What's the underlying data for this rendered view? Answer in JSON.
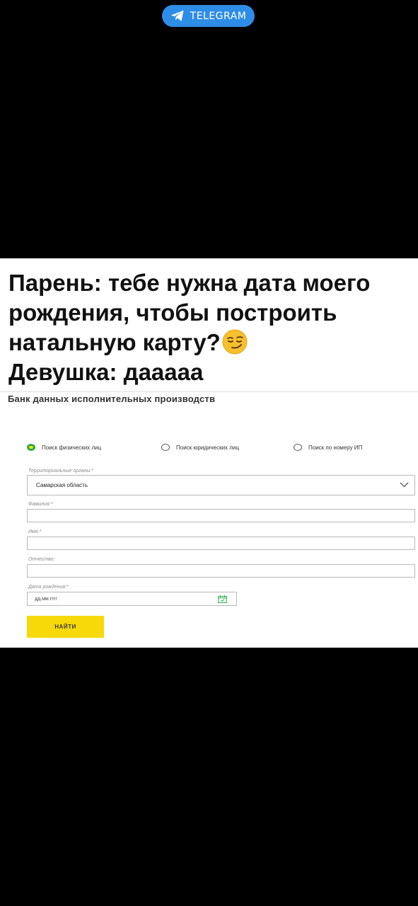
{
  "telegram_badge": {
    "label": "TELEGRAM"
  },
  "caption": {
    "lines": [
      "Парень: тебе нужна дата моего",
      "рождения, чтобы построить",
      "натальную карту?",
      "Девушка: даааaa"
    ],
    "emoji": "smirking-face"
  },
  "form": {
    "title": "Банк данных исполнительных производств",
    "radios": [
      {
        "label": "Поиск физических лиц",
        "selected": true
      },
      {
        "label": "Поиск юридических лиц",
        "selected": false
      },
      {
        "label": "Поиск по номеру ИП",
        "selected": false
      }
    ],
    "region_label": "Территориальные органы:*",
    "region_value": "Самарская область",
    "surname_label": "Фамилия:*",
    "name_label": "Имя:*",
    "patronymic_label": "Отчество:",
    "birthdate_label": "Дата рождения:*",
    "birthdate_placeholder": "дд.мм.гггг",
    "submit_label": "НАЙТИ"
  },
  "colors": {
    "telegram_blue": "#2e8de6",
    "button_yellow": "#f7d909",
    "radio_green": "#2aa84a"
  }
}
